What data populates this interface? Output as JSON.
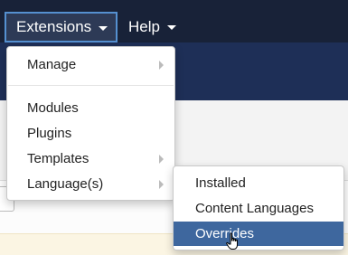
{
  "menubar": {
    "extensions_label": "Extensions",
    "help_label": "Help"
  },
  "extensions_menu": {
    "items": [
      {
        "label": "Manage",
        "has_submenu": true
      },
      {
        "label": "Modules",
        "has_submenu": false
      },
      {
        "label": "Plugins",
        "has_submenu": false
      },
      {
        "label": "Templates",
        "has_submenu": true
      },
      {
        "label": "Language(s)",
        "has_submenu": true
      }
    ]
  },
  "languages_submenu": {
    "items": [
      {
        "label": "Installed"
      },
      {
        "label": "Content Languages"
      },
      {
        "label": "Overrides",
        "highlighted": true
      }
    ]
  },
  "colors": {
    "menubar_bg": "#182238",
    "highlight": "#3e679e",
    "focus_border": "#5590d0"
  },
  "icons": {
    "caret": "caret-down-icon",
    "submenu_arrow": "chevron-right-icon",
    "cursor": "hand-pointer-icon"
  }
}
